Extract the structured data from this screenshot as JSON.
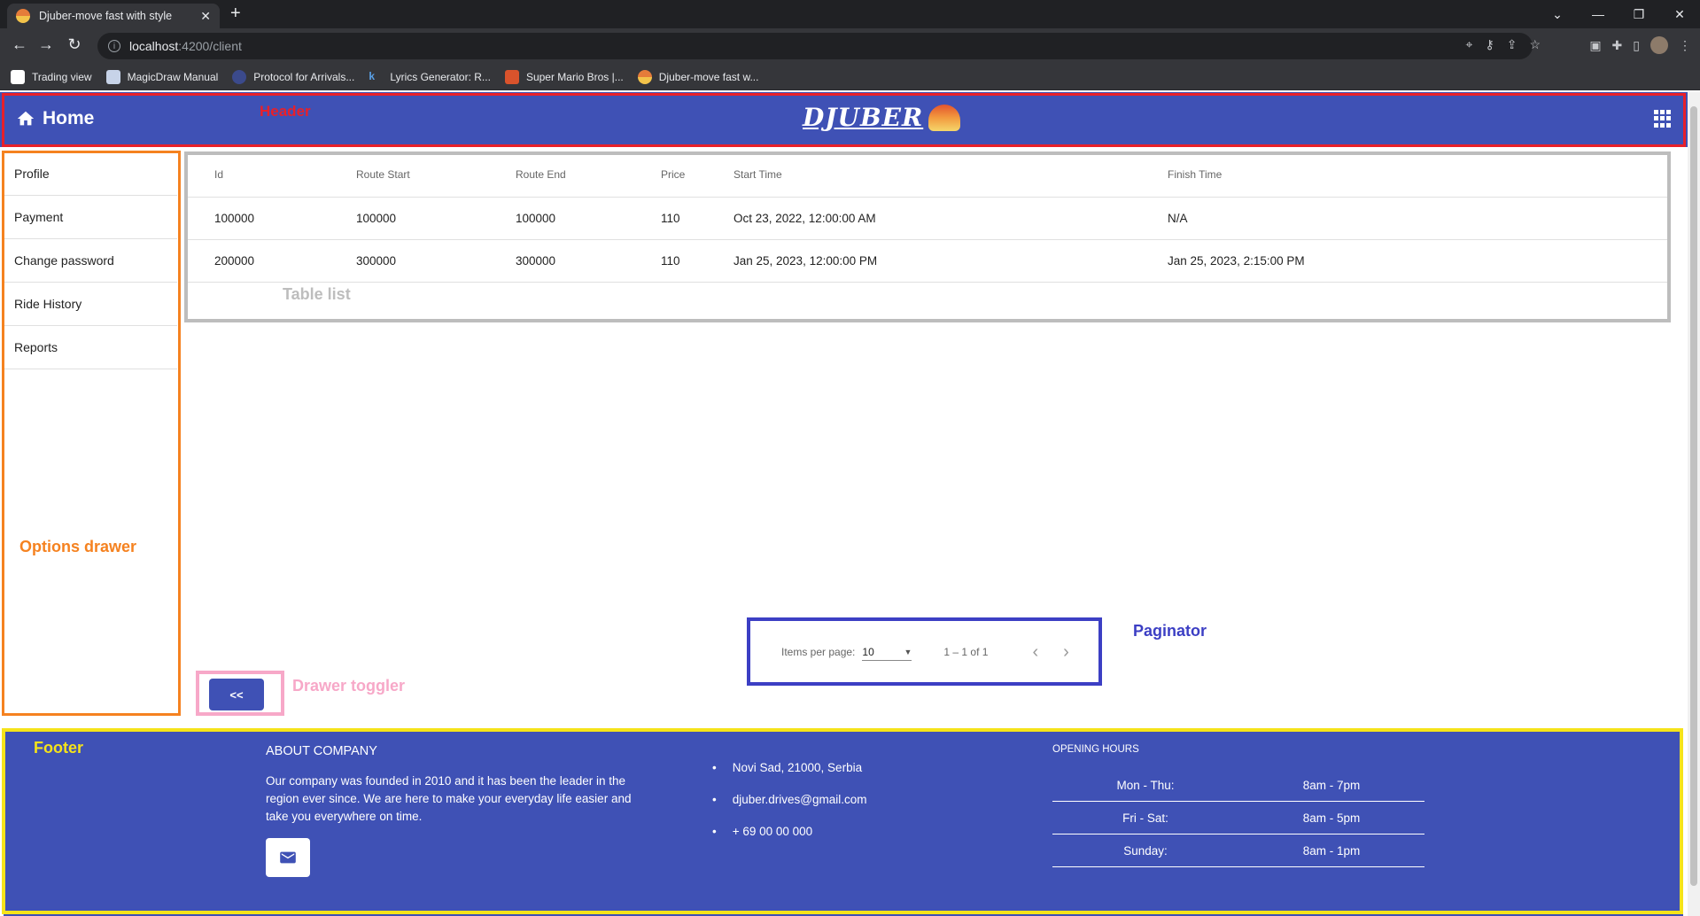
{
  "browser": {
    "tab_title": "Djuber-move fast with style",
    "url_host": "localhost",
    "url_path": ":4200/client",
    "bookmarks": [
      "Trading view",
      "MagicDraw Manual",
      "Protocol for Arrivals...",
      "Lyrics Generator: R...",
      "Super Mario Bros |...",
      "Djuber-move fast w..."
    ]
  },
  "header": {
    "home_label": "Home",
    "logo_text": "DJUBER",
    "annotation": "Header"
  },
  "drawer": {
    "items": [
      "Profile",
      "Payment",
      "Change password",
      "Ride History",
      "Reports"
    ],
    "annotation": "Options drawer"
  },
  "table": {
    "columns": [
      "Id",
      "Route Start",
      "Route End",
      "Price",
      "Start Time",
      "Finish Time"
    ],
    "rows": [
      [
        "100000",
        "100000",
        "100000",
        "110",
        "Oct 23, 2022, 12:00:00 AM",
        "N/A"
      ],
      [
        "200000",
        "300000",
        "300000",
        "110",
        "Jan 25, 2023, 12:00:00 PM",
        "Jan 25, 2023, 2:15:00 PM"
      ]
    ],
    "annotation": "Table list"
  },
  "paginator": {
    "items_per_page_label": "Items per page:",
    "page_size": "10",
    "range_label": "1 – 1 of 1",
    "annotation": "Paginator"
  },
  "toggler": {
    "label": "<<",
    "annotation": "Drawer toggler"
  },
  "footer": {
    "annotation": "Footer",
    "about_title": "ABOUT COMPANY",
    "about_text": "Our company was founded in 2010 and it has been the leader in the region ever since. We are here to make your everyday life easier and take you everywhere on time.",
    "contacts": [
      "Novi Sad, 21000, Serbia",
      "djuber.drives@gmail.com",
      "+ 69 00 00 000"
    ],
    "hours_title": "OPENING HOURS",
    "hours": [
      {
        "day": "Mon - Thu:",
        "time": "8am - 7pm"
      },
      {
        "day": "Fri - Sat:",
        "time": "8am - 5pm"
      },
      {
        "day": "Sunday:",
        "time": "8am - 1pm"
      }
    ]
  },
  "colors": {
    "primary": "#3f51b5",
    "header_box": "#e8202a",
    "drawer_box": "#f58220",
    "table_box": "#bdbdbd",
    "paginator_box": "#3c3fc4",
    "toggler_box": "#f7a8c8",
    "footer_box": "#f5e31a"
  }
}
